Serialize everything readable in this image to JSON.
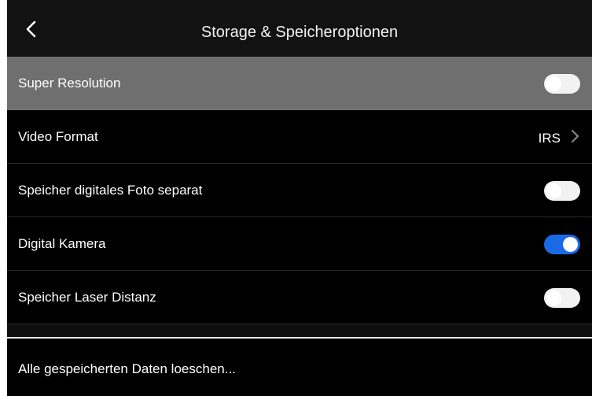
{
  "header": {
    "title": "Storage & Speicheroptionen",
    "back_icon": "chevron-left-icon"
  },
  "settings": [
    {
      "label": "Super Resolution",
      "type": "toggle",
      "state": "off",
      "selected": true
    },
    {
      "label": "Video Format",
      "type": "value",
      "value": "IRS",
      "icon": "chevron-right-icon"
    },
    {
      "label": "Speicher digitales Foto separat",
      "type": "toggle",
      "state": "off"
    },
    {
      "label": "Digital Kamera",
      "type": "toggle",
      "state": "on"
    },
    {
      "label": "Speicher Laser Distanz",
      "type": "toggle",
      "state": "off"
    }
  ],
  "actions": {
    "clear_data": "Alle gespeicherten Daten loeschen..."
  },
  "colors": {
    "accent": "#1a6ae6",
    "selected_row": "#6f6f6f",
    "background": "#000000"
  }
}
